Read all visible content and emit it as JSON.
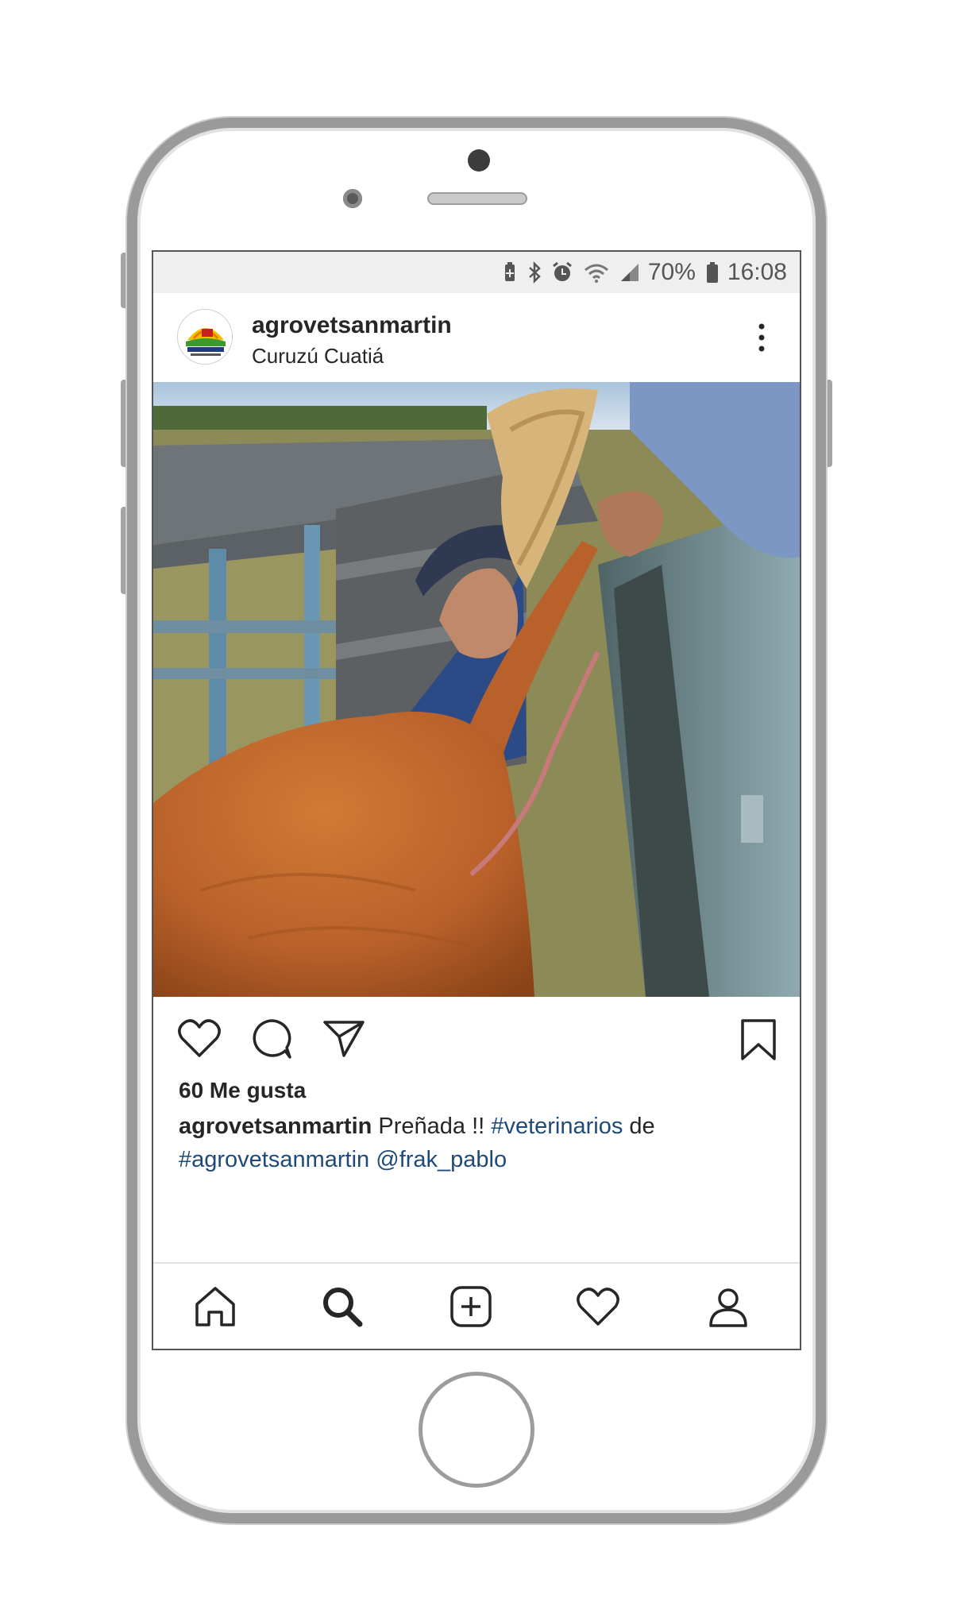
{
  "status_bar": {
    "battery_percent": "70%",
    "time": "16:08",
    "icons": [
      "battery-saver-icon",
      "bluetooth-icon",
      "alarm-icon",
      "wifi-icon",
      "signal-icon",
      "battery-icon"
    ]
  },
  "post": {
    "username": "agrovetsanmartin",
    "location": "Curuzú Cuatiá",
    "likes": "60 Me gusta",
    "caption": {
      "user": "agrovetsanmartin",
      "text_1": "Preñada !!",
      "hashtag_1": "#veterinarios",
      "text_2": "de",
      "hashtag_2": "#agrovetsanmartin",
      "mention": "@frak_pablo"
    }
  },
  "actions": [
    "like-icon",
    "comment-icon",
    "share-icon",
    "bookmark-icon"
  ],
  "tabbar": [
    "home-icon",
    "search-icon",
    "add-post-icon",
    "activity-icon",
    "profile-icon"
  ],
  "colors": {
    "link": "#1e4a7a",
    "text": "#262626"
  }
}
